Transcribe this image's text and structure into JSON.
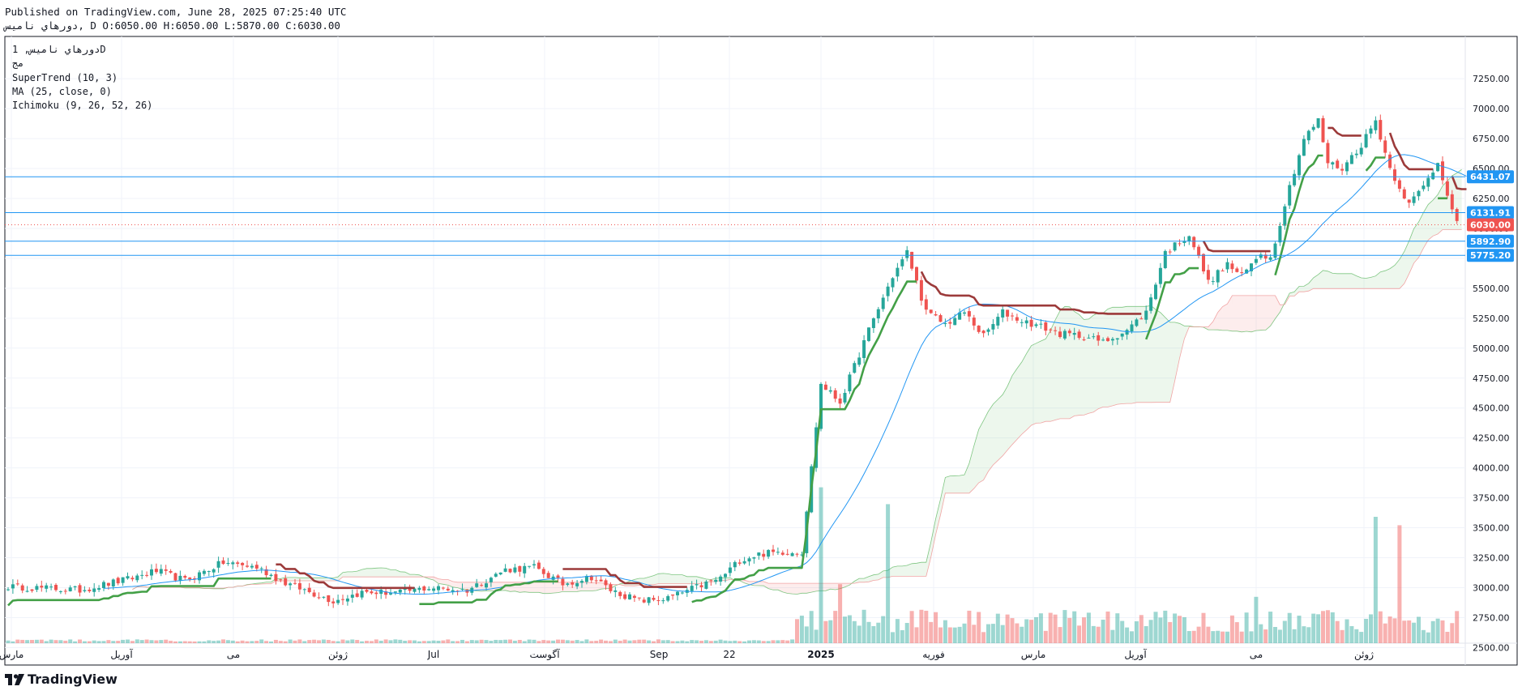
{
  "header": {
    "published": "Published on TradingView.com, June 28, 2025 07:25:40 UTC",
    "ohlc": "دورهاي نامیس, D O:6050.00 H:6050.00 L:5870.00 C:6030.00"
  },
  "legend": {
    "symbol": "دورهاي نامیس, 1D",
    "exchange": "مج",
    "indicators": [
      "SuperTrend (10, 3)",
      "MA (25, close, 0)",
      "Ichimoku (9, 26, 52, 26)"
    ]
  },
  "brand": {
    "name": "TradingView"
  },
  "colors": {
    "up": "#26a69a",
    "down": "#ef5350",
    "st_up": "#43a047",
    "st_down": "#9c3a3a",
    "ma": "#2196f3",
    "hline": "#2196f3",
    "last": "#ef5350",
    "cloud_up": "#4caf50",
    "cloud_down": "#ef9a9a"
  },
  "chart_data": {
    "type": "candlestick",
    "timeframe": "1D",
    "y_axis": {
      "ticks": [
        2500,
        2750,
        3000,
        3250,
        3500,
        3750,
        4000,
        4250,
        4500,
        4750,
        5000,
        5250,
        5500,
        5750,
        6000,
        6250,
        6500,
        6750,
        7000,
        7250
      ]
    },
    "x_axis": {
      "labels": [
        "مارس",
        "آوریل",
        "می",
        "ژوئن",
        "Jul",
        "آگوست",
        "Sep",
        "22",
        "2025",
        "فوریه",
        "مارس",
        "آوریل",
        "می",
        "ژوئن"
      ],
      "bold_label": "2025"
    },
    "horizontal_levels": [
      6431.07,
      6131.91,
      5892.9,
      5775.2
    ],
    "last_price": 6030.0,
    "indicators": [
      "SuperTrend (10, 3)",
      "MA (25, close, 0)",
      "Ichimoku (9, 26, 52, 26)"
    ],
    "close_path": [
      [
        0,
        3010
      ],
      [
        15,
        2980
      ],
      [
        25,
        3070
      ],
      [
        31,
        3140
      ],
      [
        37,
        3060
      ],
      [
        45,
        3210
      ],
      [
        52,
        3170
      ],
      [
        58,
        3040
      ],
      [
        64,
        2950
      ],
      [
        68,
        2890
      ],
      [
        74,
        2960
      ],
      [
        82,
        2960
      ],
      [
        88,
        3000
      ],
      [
        96,
        2980
      ],
      [
        104,
        3150
      ],
      [
        110,
        3170
      ],
      [
        116,
        3030
      ],
      [
        122,
        3090
      ],
      [
        126,
        2980
      ],
      [
        132,
        2890
      ],
      [
        138,
        2910
      ],
      [
        143,
        2990
      ],
      [
        149,
        3080
      ],
      [
        153,
        3230
      ],
      [
        157,
        3280
      ],
      [
        162,
        3300
      ],
      [
        166,
        3300
      ],
      [
        170,
        4700
      ],
      [
        174,
        4550
      ],
      [
        180,
        5150
      ],
      [
        185,
        5600
      ],
      [
        188,
        5800
      ],
      [
        192,
        5300
      ],
      [
        196,
        5200
      ],
      [
        200,
        5300
      ],
      [
        204,
        5100
      ],
      [
        208,
        5300
      ],
      [
        212,
        5230
      ],
      [
        216,
        5180
      ],
      [
        220,
        5120
      ],
      [
        225,
        5100
      ],
      [
        229,
        5050
      ],
      [
        234,
        5150
      ],
      [
        238,
        5300
      ],
      [
        242,
        5800
      ],
      [
        247,
        5950
      ],
      [
        251,
        5550
      ],
      [
        255,
        5700
      ],
      [
        258,
        5600
      ],
      [
        262,
        5800
      ],
      [
        264,
        5750
      ],
      [
        268,
        6350
      ],
      [
        271,
        6750
      ],
      [
        274,
        6900
      ],
      [
        276,
        6550
      ],
      [
        279,
        6500
      ],
      [
        283,
        6700
      ],
      [
        286,
        6900
      ],
      [
        289,
        6500
      ],
      [
        293,
        6200
      ],
      [
        296,
        6350
      ],
      [
        299,
        6550
      ],
      [
        301,
        6300
      ],
      [
        303,
        6050
      ],
      [
        305,
        6030
      ]
    ],
    "volume_spikes": [
      [
        170,
        3.7
      ],
      [
        174,
        1.4
      ],
      [
        184,
        3.3
      ],
      [
        261,
        1.1
      ],
      [
        286,
        3.0
      ],
      [
        291,
        2.8
      ]
    ]
  }
}
